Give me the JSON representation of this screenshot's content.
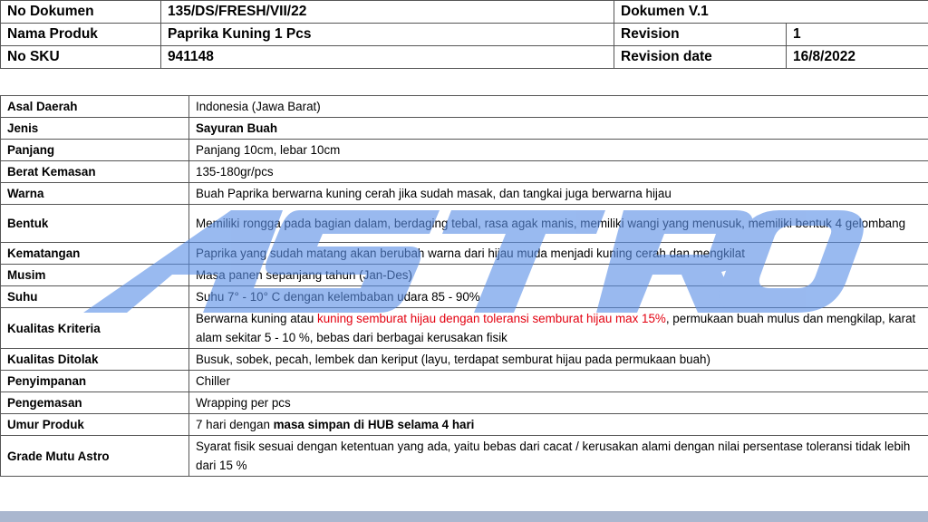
{
  "header": {
    "doc_no_label": "No Dokumen",
    "doc_no_value": "135/DS/FRESH/VII/22",
    "doc_version": "Dokumen V.1",
    "product_label": "Nama Produk",
    "product_value": "Paprika Kuning 1 Pcs",
    "revision_label": "Revision",
    "revision_value": "1",
    "sku_label": "No SKU",
    "sku_value": "941148",
    "revision_date_label": "Revision date",
    "revision_date_value": "16/8/2022"
  },
  "spec": {
    "asal_label": "Asal Daerah",
    "asal_value": "Indonesia (Jawa Barat)",
    "jenis_label": "Jenis",
    "jenis_value": "Sayuran Buah",
    "panjang_label": "Panjang",
    "panjang_value": "Panjang 10cm, lebar 10cm",
    "berat_label": "Berat Kemasan",
    "berat_value": "135-180gr/pcs",
    "warna_label": "Warna",
    "warna_value": "Buah Paprika berwarna kuning cerah jika sudah masak, dan tangkai juga berwarna  hijau",
    "bentuk_label": "Bentuk",
    "bentuk_value": "Memiliki rongga pada bagian dalam, berdaging tebal, rasa agak manis, memiliki wangi yang menusuk, memiliki bentuk  4 gelombang",
    "kematangan_label": "Kematangan",
    "kematangan_value": "Paprika yang sudah matang akan berubah warna dari hijau muda menjadi kuning cerah dan mengkilat",
    "musim_label": "Musim",
    "musim_value": "Masa panen sepanjang tahun (Jan-Des)",
    "suhu_label": "Suhu",
    "suhu_value": "Suhu 7° - 10° C dengan kelembaban udara 85 - 90%",
    "kualitas_kriteria_label": "Kualitas Kriteria",
    "kualitas_kriteria_part1": "Berwarna kuning atau ",
    "kualitas_kriteria_part2": "kuning semburat hijau dengan toleransi semburat hijau max 15%",
    "kualitas_kriteria_part3": ", permukaan buah mulus dan mengkilap, karat alam sekitar 5 - 10 %, bebas dari berbagai kerusakan fisik",
    "kualitas_ditolak_label": "Kualitas Ditolak",
    "kualitas_ditolak_value": "Busuk, sobek, pecah, lembek dan keriput (layu, terdapat semburat hijau pada permukaan buah)",
    "penyimpanan_label": "Penyimpanan",
    "penyimpanan_value": "Chiller",
    "pengemasan_label": "Pengemasan",
    "pengemasan_value": "Wrapping per pcs",
    "umur_label": "Umur Produk",
    "umur_part1": "7  hari dengan ",
    "umur_part2": "masa simpan di HUB selama 4 hari",
    "grade_label": "Grade Mutu Astro",
    "grade_value": "Syarat fisik sesuai dengan ketentuan yang ada, yaitu bebas dari cacat / kerusakan alami dengan  nilai persentase toleransi tidak lebih dari 15 %"
  },
  "watermark": {
    "text": "ASTRO",
    "color": "#5b8fe6"
  },
  "colors": {
    "highlight_red": "#e3000f",
    "border": "#555555",
    "bottom_strip": "#aab7cf"
  }
}
